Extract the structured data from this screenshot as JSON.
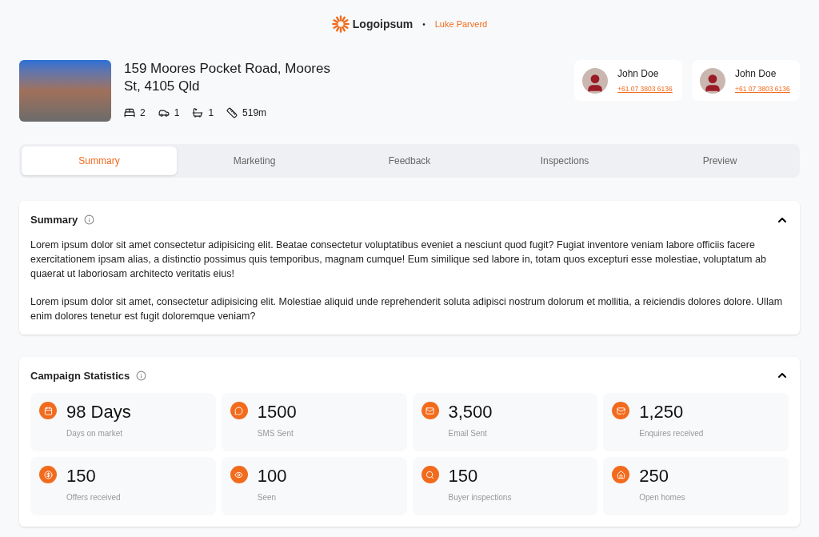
{
  "header": {
    "logo": "Logoipsum",
    "separator": "•",
    "user": "Luke Parverd"
  },
  "property": {
    "address": "159 Moores Pocket Road, Moores St, 4105 Qld",
    "features": [
      {
        "kind": "bed",
        "value": "2"
      },
      {
        "kind": "car",
        "value": "1"
      },
      {
        "kind": "bath",
        "value": "1"
      },
      {
        "kind": "area",
        "value": "519m"
      }
    ]
  },
  "agents": [
    {
      "name": "John Doe",
      "phone": "+61 07 3803 6136"
    },
    {
      "name": "John Doe",
      "phone": "+61 07 3803 6136"
    }
  ],
  "tabs": [
    {
      "label": "Summary",
      "selected": true
    },
    {
      "label": "Marketing",
      "selected": false
    },
    {
      "label": "Feedback",
      "selected": false
    },
    {
      "label": "Inspections",
      "selected": false
    },
    {
      "label": "Preview",
      "selected": false
    }
  ],
  "summary": {
    "title": "Summary",
    "expanded": true,
    "paragraphs": [
      "Lorem ipsum dolor sit amet consectetur adipisicing elit. Beatae consectetur voluptatibus eveniet a nesciunt quod fugit? Fugiat inventore veniam labore officiis facere exercitationem ipsam alias, a distinctio possimus quis temporibus, magnam cumque! Eum similique sed labore in, totam quos excepturi esse molestiae, voluptatum ab quaerat ut laboriosam architecto veritatis eius!",
      "Lorem ipsum dolor sit amet, consectetur adipisicing elit. Molestiae aliquid unde reprehenderit soluta adipisci nostrum dolorum et mollitia, a reiciendis dolores dolore. Ullam enim dolores tenetur est fugit doloremque veniam?"
    ]
  },
  "campaign": {
    "title": "Campaign Statistics",
    "expanded": true,
    "stats": [
      {
        "kind": "calendar",
        "value": "98 Days",
        "label": "Days on market"
      },
      {
        "kind": "message",
        "value": "1500",
        "label": "SMS Sent"
      },
      {
        "kind": "mail",
        "value": "3,500",
        "label": "Email Sent"
      },
      {
        "kind": "mail-check",
        "value": "1,250",
        "label": "Enquires received"
      },
      {
        "kind": "dollar",
        "value": "150",
        "label": "Offers received"
      },
      {
        "kind": "eye",
        "value": "100",
        "label": "Seen"
      },
      {
        "kind": "search",
        "value": "150",
        "label": "Buyer inspections"
      },
      {
        "kind": "home",
        "value": "250",
        "label": "Open homes"
      }
    ]
  }
}
